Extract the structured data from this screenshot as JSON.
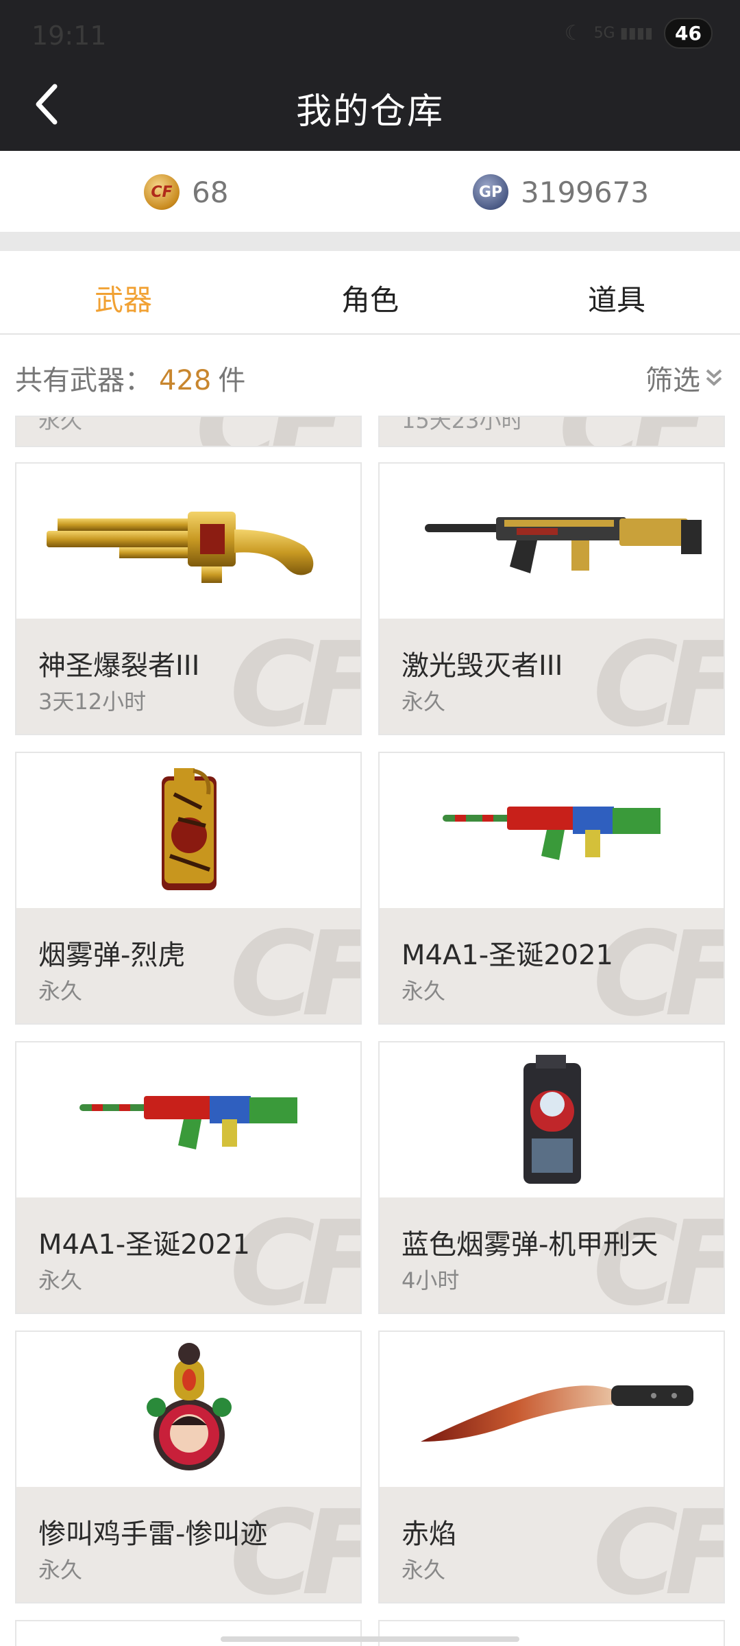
{
  "status": {
    "time": "19:11",
    "battery": "46",
    "signal": "5G"
  },
  "header": {
    "title": "我的仓库"
  },
  "currency": [
    {
      "icon": "cf-coin-icon",
      "value": "68"
    },
    {
      "icon": "gp-coin-icon",
      "value": "3199673"
    }
  ],
  "tabs": [
    {
      "label": "武器",
      "active": true
    },
    {
      "label": "角色",
      "active": false
    },
    {
      "label": "道具",
      "active": false
    }
  ],
  "count": {
    "prefix": "共有武器：",
    "number": "428",
    "unit": "件",
    "filter": "筛选"
  },
  "partial_top": [
    {
      "duration": "永久"
    },
    {
      "duration": "15天23小时"
    }
  ],
  "items": [
    {
      "name": "神圣爆裂者III",
      "duration": "3天12小时",
      "image": "golden-shotgun"
    },
    {
      "name": "激光毁灭者III",
      "duration": "永久",
      "image": "gold-black-rifle"
    },
    {
      "name": "烟雾弹-烈虎",
      "duration": "永久",
      "image": "tiger-smoke-grenade"
    },
    {
      "name": "M4A1-圣诞2021",
      "duration": "永久",
      "image": "christmas-rifle"
    },
    {
      "name": "M4A1-圣诞2021",
      "duration": "永久",
      "image": "christmas-rifle"
    },
    {
      "name": "蓝色烟雾弹-机甲刑天",
      "duration": "4小时",
      "image": "mecha-smoke-grenade"
    },
    {
      "name": "惨叫鸡手雷-惨叫迹",
      "duration": "永久",
      "image": "chicken-grenade"
    },
    {
      "name": "赤焰",
      "duration": "永久",
      "image": "red-kukri-knife"
    }
  ],
  "watermark": "CF"
}
